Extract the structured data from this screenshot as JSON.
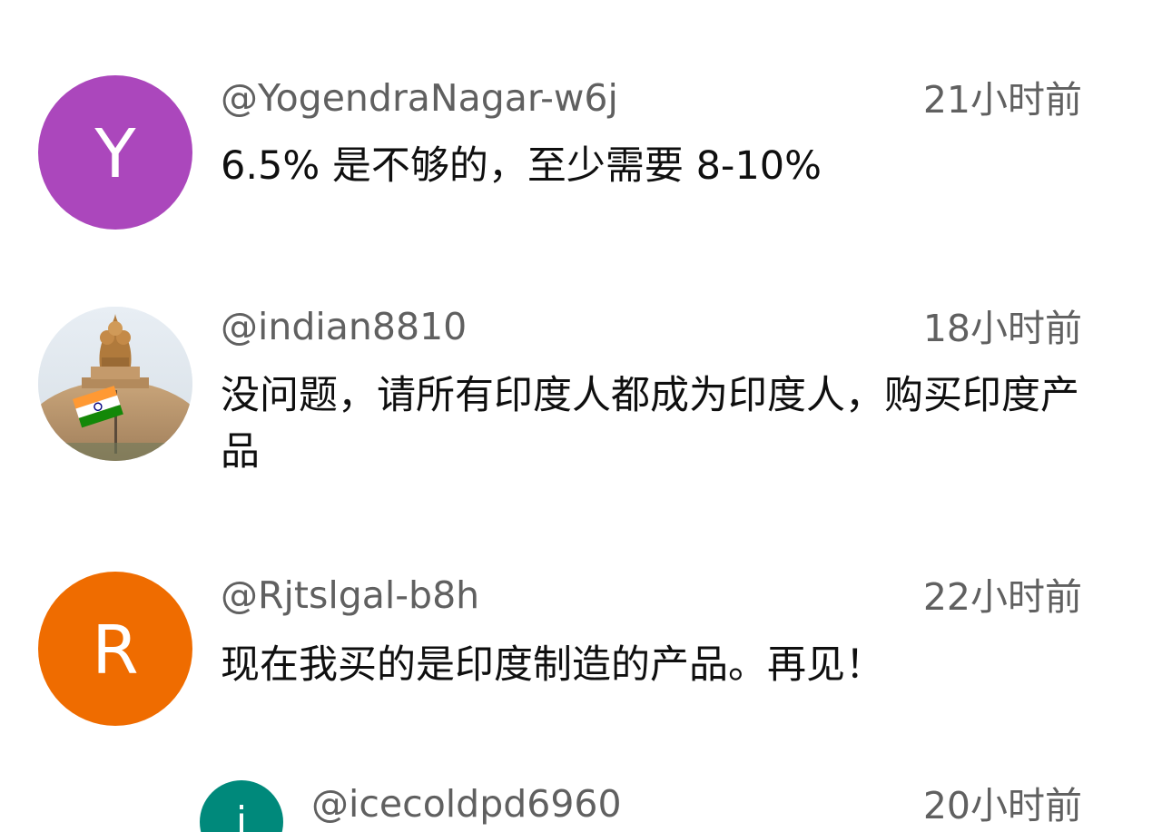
{
  "comments": [
    {
      "avatar": {
        "letter": "Y",
        "color": "#ab47bc"
      },
      "handle": "@YogendraNagar-w6j",
      "time": "21小时前",
      "text": "6.5% 是不够的，至少需要 8-10%"
    },
    {
      "avatar": {
        "type": "image",
        "description_icon": "ashoka-emblem-flag-icon"
      },
      "handle": "@indian8810",
      "time": "18小时前",
      "text": "没问题，请所有印度人都成为印度人，购买印度产品"
    },
    {
      "avatar": {
        "letter": "R",
        "color": "#ef6c00"
      },
      "handle": "@Rjtslgal-b8h",
      "time": "22小时前",
      "text": "现在我买的是印度制造的产品。再见！"
    },
    {
      "avatar": {
        "letter": "i",
        "color": "#00897b"
      },
      "handle": "@icecoldpd6960",
      "time": "20小时前",
      "text": ""
    }
  ]
}
